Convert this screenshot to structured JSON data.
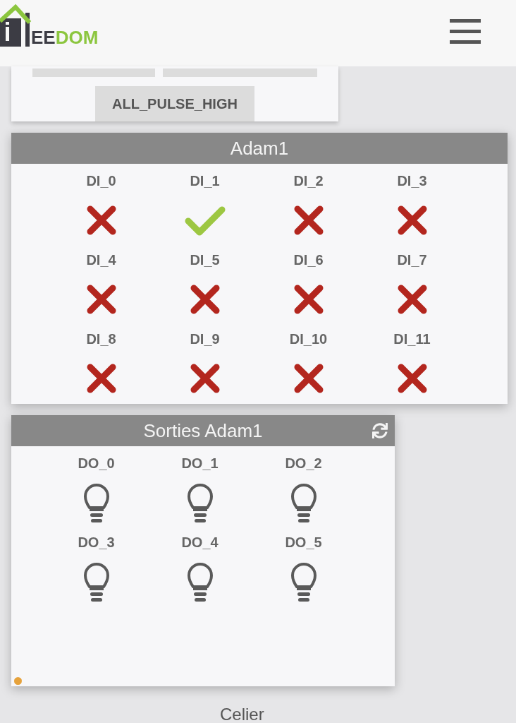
{
  "header": {
    "logo": {
      "parts": [
        {
          "text": "EE",
          "kind": "dark"
        },
        {
          "text": "DOM",
          "kind": "accent"
        }
      ]
    }
  },
  "top_card": {
    "button": "ALL_PULSE_HIGH"
  },
  "cards": [
    {
      "title": "Adam1",
      "kind": "inputs",
      "refresh": false,
      "items": [
        {
          "label": "DI_0",
          "on": false
        },
        {
          "label": "DI_1",
          "on": true
        },
        {
          "label": "DI_2",
          "on": false
        },
        {
          "label": "DI_3",
          "on": false
        },
        {
          "label": "DI_4",
          "on": false
        },
        {
          "label": "DI_5",
          "on": false
        },
        {
          "label": "DI_6",
          "on": false
        },
        {
          "label": "DI_7",
          "on": false
        },
        {
          "label": "DI_8",
          "on": false
        },
        {
          "label": "DI_9",
          "on": false
        },
        {
          "label": "DI_10",
          "on": false
        },
        {
          "label": "DI_11",
          "on": false
        }
      ]
    },
    {
      "title": "Sorties Adam1",
      "kind": "outputs",
      "refresh": true,
      "items": [
        {
          "label": "DO_0",
          "on": false
        },
        {
          "label": "DO_1",
          "on": false
        },
        {
          "label": "DO_2",
          "on": false
        },
        {
          "label": "DO_3",
          "on": false
        },
        {
          "label": "DO_4",
          "on": false
        },
        {
          "label": "DO_5",
          "on": false
        }
      ],
      "status_dot": {
        "color": "#e6a23c"
      }
    }
  ],
  "next_section": {
    "title": "Celier"
  }
}
